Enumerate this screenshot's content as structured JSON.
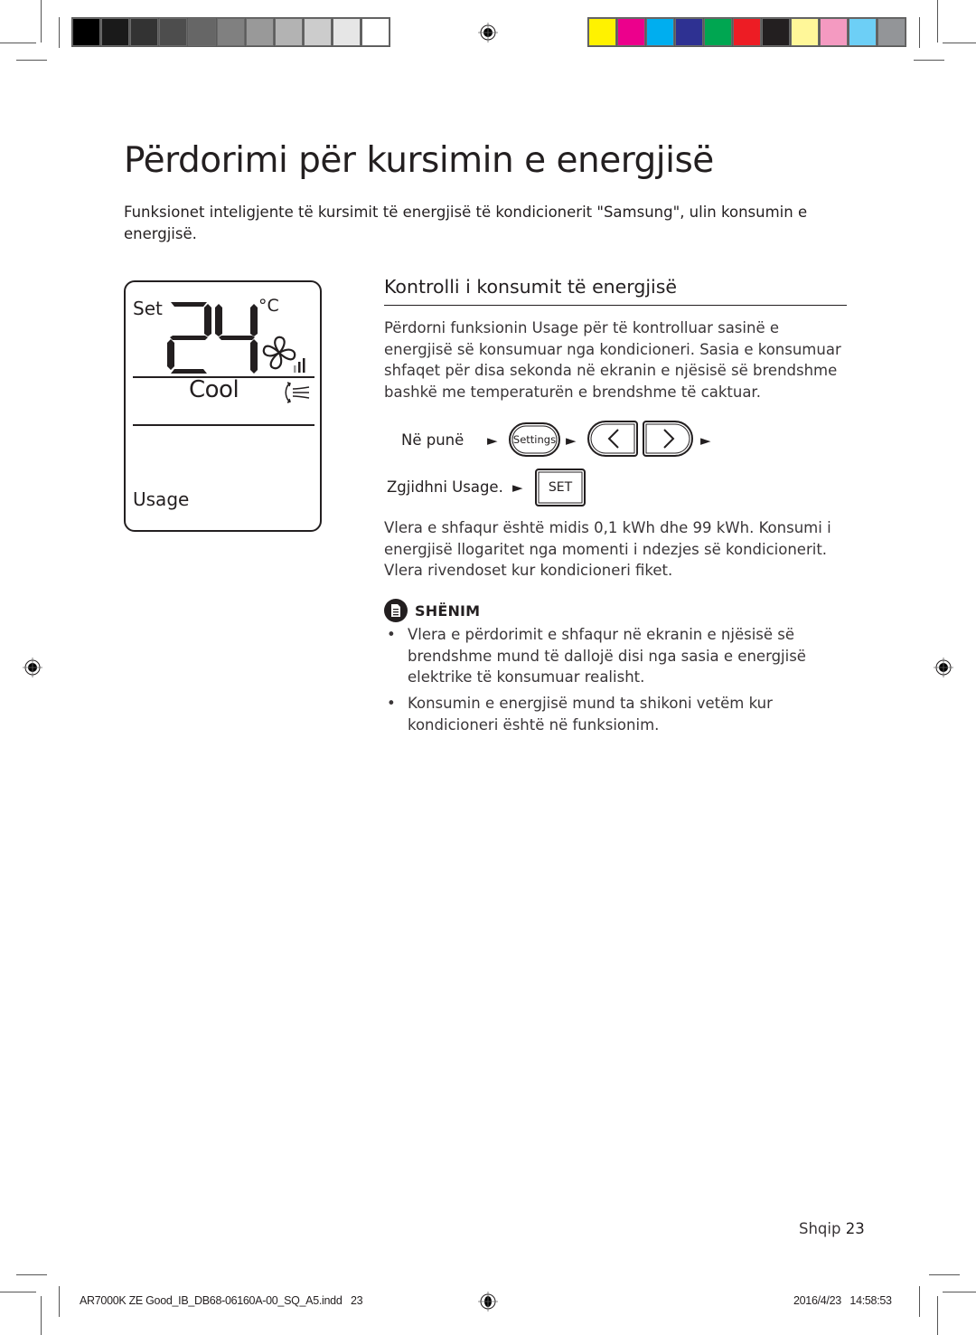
{
  "print_marks": {
    "grayscale_swatches": [
      "#000000",
      "#1a1a1a",
      "#333333",
      "#4d4d4d",
      "#666666",
      "#808080",
      "#999999",
      "#b3b3b3",
      "#cccccc",
      "#e6e6e6",
      "#ffffff"
    ],
    "color_swatches": [
      "#fff200",
      "#ec008c",
      "#00aeef",
      "#2e3192",
      "#00a651",
      "#ed1c24",
      "#231f20",
      "#fff799",
      "#f49ac1",
      "#6dcff6",
      "#939598"
    ]
  },
  "page": {
    "title": "Përdorimi për kursimin e energjisë",
    "intro": "Funksionet inteligjente të kursimit të energjisë të kondicionerit \"Samsung\", ulin konsumin e energjisë."
  },
  "lcd_display": {
    "set_label": "Set",
    "temperature": "24",
    "unit": "°C",
    "mode": "Cool",
    "function_label": "Usage",
    "fan_icon": "fan-icon",
    "airflow_icon": "airflow-swing-icon"
  },
  "section": {
    "title": "Kontrolli i konsumit të energjisë",
    "paragraph1": "Përdorni funksionin Usage për të kontrolluar sasinë e energjisë së konsumuar nga kondicioneri. Sasia e konsumuar shfaqet për disa sekonda në ekranin e njësisë së brendshme bashkë me temperaturën e brendshme të caktuar.",
    "steps": {
      "step1_label": "Në punë",
      "settings_button": "Settings",
      "step2_label": "Zgjidhni Usage.",
      "set_button": "SET",
      "arrow": "►"
    },
    "paragraph2": "Vlera e shfaqur është midis 0,1 kWh dhe 99 kWh. Konsumi i energjisë llogaritet nga momenti i ndezjes së kondicionerit. Vlera rivendoset kur kondicioneri fiket."
  },
  "note": {
    "label": "SHËNIM",
    "bullets": [
      "Vlera e përdorimit e shfaqur në ekranin e njësisë së brendshme mund të dallojë disi nga sasia e energjisë elektrike të konsumuar realisht.",
      "Konsumin e energjisë mund ta shikoni vetëm kur kondicioneri është në funksionim."
    ],
    "bullet_char": "•"
  },
  "footer": {
    "language": "Shqip",
    "page_number": "23"
  },
  "slug": {
    "file": "AR7000K ZE Good_IB_DB68-06160A-00_SQ_A5.indd   23",
    "datetime": "2016/4/23   14:58:53"
  }
}
